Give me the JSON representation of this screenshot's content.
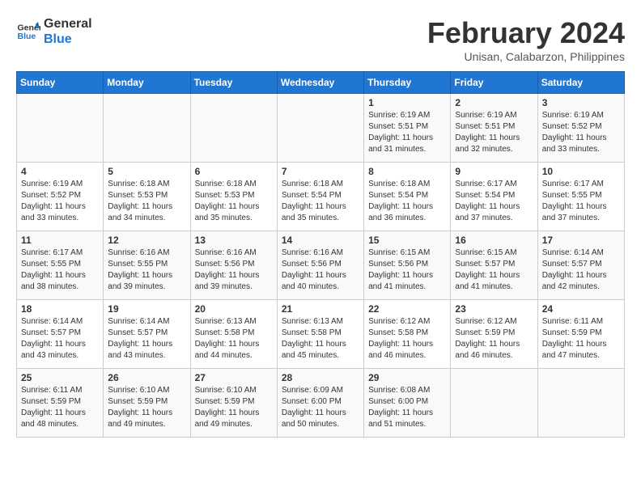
{
  "header": {
    "logo_line1": "General",
    "logo_line2": "Blue",
    "month_year": "February 2024",
    "location": "Unisan, Calabarzon, Philippines"
  },
  "days_of_week": [
    "Sunday",
    "Monday",
    "Tuesday",
    "Wednesday",
    "Thursday",
    "Friday",
    "Saturday"
  ],
  "weeks": [
    [
      {
        "num": "",
        "detail": ""
      },
      {
        "num": "",
        "detail": ""
      },
      {
        "num": "",
        "detail": ""
      },
      {
        "num": "",
        "detail": ""
      },
      {
        "num": "1",
        "detail": "Sunrise: 6:19 AM\nSunset: 5:51 PM\nDaylight: 11 hours\nand 31 minutes."
      },
      {
        "num": "2",
        "detail": "Sunrise: 6:19 AM\nSunset: 5:51 PM\nDaylight: 11 hours\nand 32 minutes."
      },
      {
        "num": "3",
        "detail": "Sunrise: 6:19 AM\nSunset: 5:52 PM\nDaylight: 11 hours\nand 33 minutes."
      }
    ],
    [
      {
        "num": "4",
        "detail": "Sunrise: 6:19 AM\nSunset: 5:52 PM\nDaylight: 11 hours\nand 33 minutes."
      },
      {
        "num": "5",
        "detail": "Sunrise: 6:18 AM\nSunset: 5:53 PM\nDaylight: 11 hours\nand 34 minutes."
      },
      {
        "num": "6",
        "detail": "Sunrise: 6:18 AM\nSunset: 5:53 PM\nDaylight: 11 hours\nand 35 minutes."
      },
      {
        "num": "7",
        "detail": "Sunrise: 6:18 AM\nSunset: 5:54 PM\nDaylight: 11 hours\nand 35 minutes."
      },
      {
        "num": "8",
        "detail": "Sunrise: 6:18 AM\nSunset: 5:54 PM\nDaylight: 11 hours\nand 36 minutes."
      },
      {
        "num": "9",
        "detail": "Sunrise: 6:17 AM\nSunset: 5:54 PM\nDaylight: 11 hours\nand 37 minutes."
      },
      {
        "num": "10",
        "detail": "Sunrise: 6:17 AM\nSunset: 5:55 PM\nDaylight: 11 hours\nand 37 minutes."
      }
    ],
    [
      {
        "num": "11",
        "detail": "Sunrise: 6:17 AM\nSunset: 5:55 PM\nDaylight: 11 hours\nand 38 minutes."
      },
      {
        "num": "12",
        "detail": "Sunrise: 6:16 AM\nSunset: 5:55 PM\nDaylight: 11 hours\nand 39 minutes."
      },
      {
        "num": "13",
        "detail": "Sunrise: 6:16 AM\nSunset: 5:56 PM\nDaylight: 11 hours\nand 39 minutes."
      },
      {
        "num": "14",
        "detail": "Sunrise: 6:16 AM\nSunset: 5:56 PM\nDaylight: 11 hours\nand 40 minutes."
      },
      {
        "num": "15",
        "detail": "Sunrise: 6:15 AM\nSunset: 5:56 PM\nDaylight: 11 hours\nand 41 minutes."
      },
      {
        "num": "16",
        "detail": "Sunrise: 6:15 AM\nSunset: 5:57 PM\nDaylight: 11 hours\nand 41 minutes."
      },
      {
        "num": "17",
        "detail": "Sunrise: 6:14 AM\nSunset: 5:57 PM\nDaylight: 11 hours\nand 42 minutes."
      }
    ],
    [
      {
        "num": "18",
        "detail": "Sunrise: 6:14 AM\nSunset: 5:57 PM\nDaylight: 11 hours\nand 43 minutes."
      },
      {
        "num": "19",
        "detail": "Sunrise: 6:14 AM\nSunset: 5:57 PM\nDaylight: 11 hours\nand 43 minutes."
      },
      {
        "num": "20",
        "detail": "Sunrise: 6:13 AM\nSunset: 5:58 PM\nDaylight: 11 hours\nand 44 minutes."
      },
      {
        "num": "21",
        "detail": "Sunrise: 6:13 AM\nSunset: 5:58 PM\nDaylight: 11 hours\nand 45 minutes."
      },
      {
        "num": "22",
        "detail": "Sunrise: 6:12 AM\nSunset: 5:58 PM\nDaylight: 11 hours\nand 46 minutes."
      },
      {
        "num": "23",
        "detail": "Sunrise: 6:12 AM\nSunset: 5:59 PM\nDaylight: 11 hours\nand 46 minutes."
      },
      {
        "num": "24",
        "detail": "Sunrise: 6:11 AM\nSunset: 5:59 PM\nDaylight: 11 hours\nand 47 minutes."
      }
    ],
    [
      {
        "num": "25",
        "detail": "Sunrise: 6:11 AM\nSunset: 5:59 PM\nDaylight: 11 hours\nand 48 minutes."
      },
      {
        "num": "26",
        "detail": "Sunrise: 6:10 AM\nSunset: 5:59 PM\nDaylight: 11 hours\nand 49 minutes."
      },
      {
        "num": "27",
        "detail": "Sunrise: 6:10 AM\nSunset: 5:59 PM\nDaylight: 11 hours\nand 49 minutes."
      },
      {
        "num": "28",
        "detail": "Sunrise: 6:09 AM\nSunset: 6:00 PM\nDaylight: 11 hours\nand 50 minutes."
      },
      {
        "num": "29",
        "detail": "Sunrise: 6:08 AM\nSunset: 6:00 PM\nDaylight: 11 hours\nand 51 minutes."
      },
      {
        "num": "",
        "detail": ""
      },
      {
        "num": "",
        "detail": ""
      }
    ]
  ]
}
